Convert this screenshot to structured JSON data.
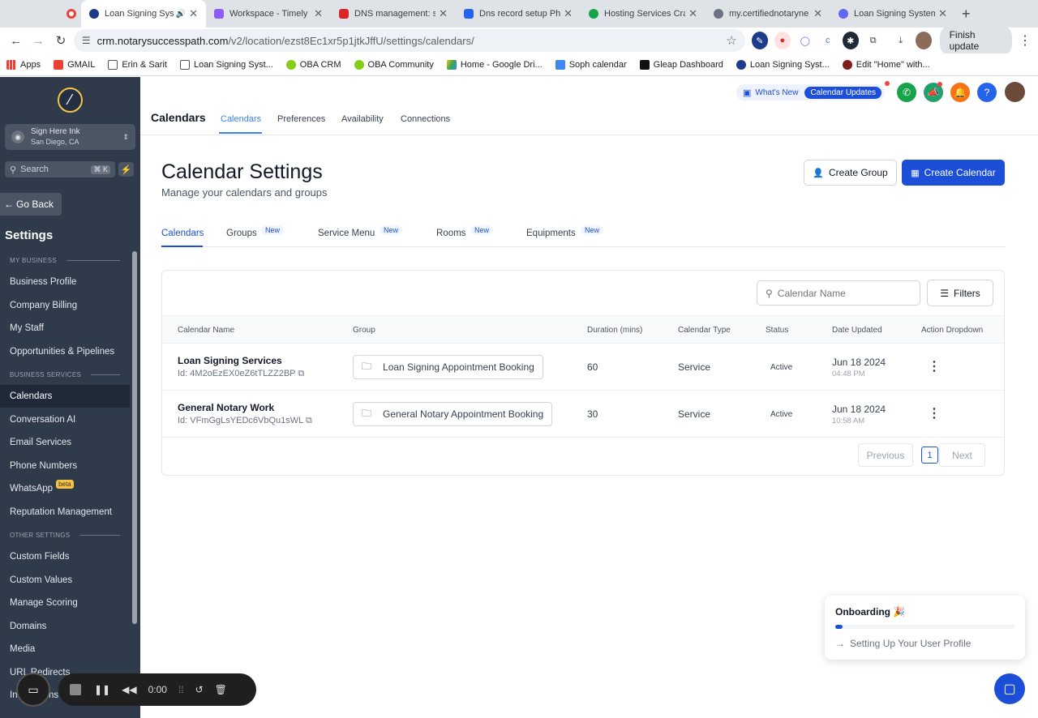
{
  "browser": {
    "tabs": [
      {
        "label": "",
        "color": "#ea4335"
      },
      {
        "label": "Loan Signing Syst",
        "color": "#1e3a8a",
        "active": true
      },
      {
        "label": "Workspace - Timely",
        "color": "#8b5cf6"
      },
      {
        "label": "DNS management: sc",
        "color": "#dc2626"
      },
      {
        "label": "Dns record setup Pho",
        "color": "#2563eb"
      },
      {
        "label": "Hosting Services Cra",
        "color": "#16a34a"
      },
      {
        "label": "my.certifiednotaryne",
        "color": "#6b7280"
      },
      {
        "label": "Loan Signing System",
        "color": "#6366f1"
      }
    ],
    "url_host": "crm.notarysuccesspath.com",
    "url_path": "/v2/location/ezst8Ec1xr5p1jtkJffU/settings/calendars/",
    "finish_update": "Finish update",
    "bookmarks": [
      "Apps",
      "GMAIL",
      "Erin & Sarit",
      "Loan Signing Syst...",
      "OBA CRM",
      "OBA Community",
      "Home - Google Dri...",
      "Soph calendar",
      "Gleap Dashboard",
      "Loan Signing Syst...",
      "Edit \"Home\" with..."
    ]
  },
  "sidebar": {
    "location_name": "Sign Here Ink",
    "location_sub": "San Diego, CA",
    "search_placeholder": "Search",
    "search_kbd": "⌘ K",
    "go_back": "Go Back",
    "heading": "Settings",
    "sections": {
      "my_business": "MY BUSINESS",
      "business_services": "BUSINESS SERVICES",
      "other_settings": "OTHER SETTINGS"
    },
    "items": {
      "business_profile": "Business Profile",
      "company_billing": "Company Billing",
      "my_staff": "My Staff",
      "opportunities": "Opportunities & Pipelines",
      "calendars": "Calendars",
      "conversation_ai": "Conversation AI",
      "email_services": "Email Services",
      "phone_numbers": "Phone Numbers",
      "whatsapp": "WhatsApp",
      "whatsapp_badge": "beta",
      "reputation": "Reputation Management",
      "custom_fields": "Custom Fields",
      "custom_values": "Custom Values",
      "manage_scoring": "Manage Scoring",
      "domains": "Domains",
      "media": "Media",
      "url_redirects": "URL Redirects",
      "integrations": "Integrations"
    }
  },
  "header": {
    "title": "Calendars",
    "tabs": [
      "Calendars",
      "Preferences",
      "Availability",
      "Connections"
    ],
    "whats_new": "What's New",
    "calendar_updates": "Calendar Updates"
  },
  "main": {
    "title": "Calendar Settings",
    "subtitle": "Manage your calendars and groups",
    "create_group": "Create Group",
    "create_calendar": "Create Calendar",
    "subtabs": [
      "Calendars",
      "Groups",
      "Service Menu",
      "Rooms",
      "Equipments"
    ],
    "new_badge": "New",
    "search_placeholder": "Calendar Name",
    "filters": "Filters",
    "columns": [
      "Calendar Name",
      "Group",
      "Duration (mins)",
      "Calendar Type",
      "Status",
      "Date Updated",
      "Action Dropdown"
    ],
    "rows": [
      {
        "name": "Loan Signing Services",
        "id": "Id: 4M2oEzEX0eZ6tTLZZ2BP",
        "group": "Loan Signing Appointment Booking",
        "duration": "60",
        "type": "Service",
        "status": "Active",
        "date": "Jun 18 2024",
        "time": "04:48 PM"
      },
      {
        "name": "General Notary Work",
        "id": "Id: VFmGgLsYEDc6VbQu1sWL",
        "group": "General Notary Appointment Booking",
        "duration": "30",
        "type": "Service",
        "status": "Active",
        "date": "Jun 18 2024",
        "time": "10:58 AM"
      }
    ],
    "pagination": {
      "previous": "Previous",
      "page": "1",
      "next": "Next"
    }
  },
  "onboarding": {
    "title": "Onboarding 🎉",
    "step": "Setting Up Your User Profile",
    "progress": 0.04
  },
  "recorder": {
    "time": "0:00"
  }
}
